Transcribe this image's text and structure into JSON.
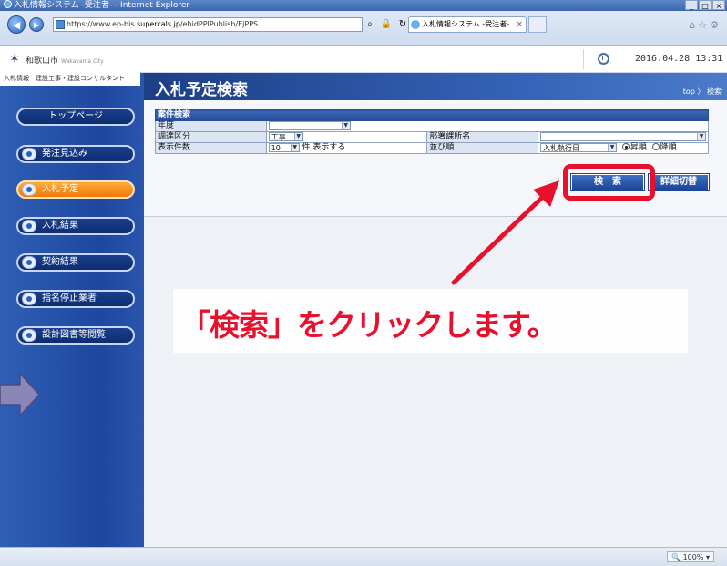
{
  "window": {
    "title": "入札情報システム -受注者- - Internet Explorer",
    "controls": [
      "_",
      "□",
      "×"
    ]
  },
  "browser": {
    "address_prefix": "https://www.ep-bis.",
    "address_domain": "supercals.jp",
    "address_path": "/ebidPPIPublish/EjPPS",
    "tab_title": "入札情報システム -受注者-",
    "tab_close": "×",
    "back_glyph": "◀",
    "forward_glyph": "▶",
    "tools_glyphs": [
      "⌂",
      "☆",
      "⚙"
    ],
    "zoom": "100%"
  },
  "site": {
    "logo_text": "和歌山市",
    "logo_sub": "Wakayama City",
    "caption": "入札情報　建設工事・建設コンサルタント",
    "datetime": "2016.04.28 13:31"
  },
  "sidebar": {
    "items": [
      {
        "label": "トップページ",
        "icon": "none",
        "active": false
      },
      {
        "label": "発注見込み",
        "icon": "pill-icon",
        "active": false
      },
      {
        "label": "入札予定",
        "icon": "pill-icon",
        "active": true
      },
      {
        "label": "入札結果",
        "icon": "pill-icon",
        "active": false
      },
      {
        "label": "契約結果",
        "icon": "pill-icon",
        "active": false
      },
      {
        "label": "指名停止業者",
        "icon": "pill-icon",
        "active": false
      },
      {
        "label": "設計図書等閲覧",
        "icon": "pill-icon",
        "active": false
      }
    ]
  },
  "main": {
    "page_title": "入札予定検索",
    "breadcrumb": "top 〉 検索",
    "search": {
      "header": "案件検索",
      "fields": {
        "year_label": "年度",
        "year_value": "",
        "procurement_label": "調達区分",
        "procurement_value": "工事",
        "dept_label": "部署課所名",
        "dept_value": "",
        "count_label": "表示件数",
        "count_value": "10",
        "count_suffix": "件 表示する",
        "sort_label": "並び順",
        "sort_value": "入札執行日",
        "order_asc": "昇順",
        "order_desc": "降順"
      },
      "search_button": "検　索",
      "toggle_button": "詳細切替"
    },
    "callout": "「検索」をクリックします。"
  },
  "colors": {
    "accent_red": "#e8112d",
    "sidebar_blue": "#1e47a0",
    "active_orange": "#ee7a0a"
  }
}
